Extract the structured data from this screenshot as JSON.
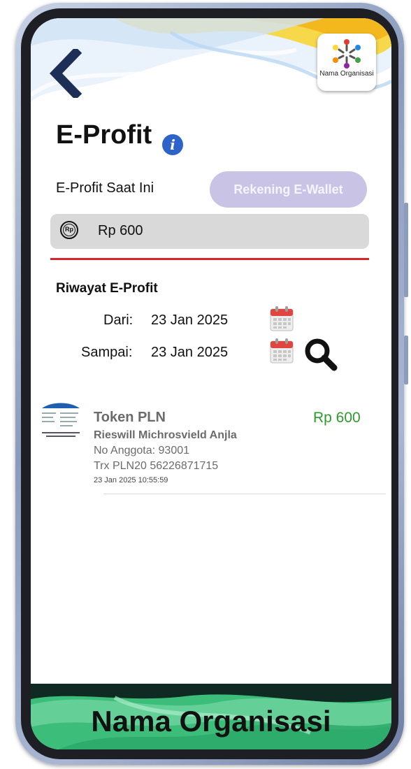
{
  "header": {
    "org_badge_name": "Nama Organisasi"
  },
  "page": {
    "title": "E-Profit"
  },
  "balance": {
    "label": "E-Profit Saat Ini",
    "wallet_button": "Rekening E-Wallet",
    "currency_icon_text": "Rp",
    "value": "Rp 600"
  },
  "history": {
    "title": "Riwayat E-Profit",
    "from_label": "Dari:",
    "from_value": "23 Jan 2025",
    "to_label": "Sampai:",
    "to_value": "23 Jan 2025"
  },
  "transactions": [
    {
      "name": "Token PLN",
      "person": "Rieswill Michrosvield Anjla",
      "member": "No Anggota: 93001",
      "trx": "Trx PLN20 56226871715",
      "time": "23 Jan 2025 10:55:59",
      "amount": "Rp 600"
    }
  ],
  "footer": {
    "org_name": "Nama Organisasi"
  },
  "colors": {
    "accent_red": "#d6262c",
    "amount_green": "#2c9a2c",
    "wallet_button": "#c9c4e6",
    "info_blue": "#2e63c9"
  },
  "icons": [
    "back-arrow-icon",
    "info-icon",
    "rupiah-coin-icon",
    "calendar-icon",
    "search-icon"
  ]
}
